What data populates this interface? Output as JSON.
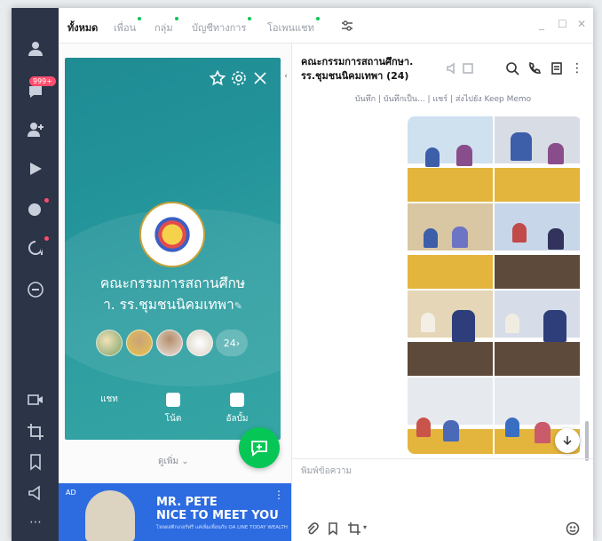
{
  "tabs": [
    {
      "label": "ทั้งหมด",
      "active": true
    },
    {
      "label": "เพื่อน",
      "active": false
    },
    {
      "label": "กลุ่ม",
      "active": false
    },
    {
      "label": "บัญชีทางการ",
      "active": false
    },
    {
      "label": "โอเพนแชท",
      "active": false
    }
  ],
  "rail": {
    "badge": "999+"
  },
  "popup": {
    "group_name_line1": "คณะกรรมการสถานศึกษ",
    "group_name_line2": "า. รร.ชุมชนนิคมเทพา",
    "member_count": "24",
    "actions": [
      {
        "label": "แชท",
        "icon": "chat-icon"
      },
      {
        "label": "โน้ต",
        "icon": "note-icon"
      },
      {
        "label": "อัลบั้ม",
        "icon": "album-icon"
      }
    ]
  },
  "list": {
    "more_label": "ดูเพิ่ม"
  },
  "ad": {
    "tag": "AD",
    "title_line1": "MR. PETE",
    "title_line2": "NICE TO MEET YOU",
    "subtitle": "โหลดสติกเกอร์ฟรี แค่เพิ่มเพื่อนกับ OA LINE TODAY WEALTH"
  },
  "chat": {
    "title_line1": "คณะกรรมการสถานศึกษา.",
    "title_line2": "รร.ชุมชนนิคมเทพา (24)",
    "pin_bar": "บันทึก | บันทึกเป็น... | แชร์ | ส่งไปยัง Keep Memo",
    "input_placeholder": "พิมพ์ข้อความ"
  },
  "colors": {
    "rail": "#2c3447",
    "accent_green": "#06c755",
    "popup_teal": "#23949a",
    "ad_blue": "#2d6be0"
  }
}
